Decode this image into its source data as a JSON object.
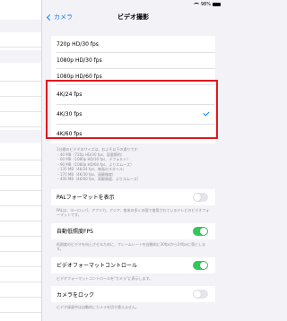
{
  "status_bar": {
    "battery_percent": "98%"
  },
  "nav": {
    "back_label": "カメラ",
    "title": "ビデオ撮影"
  },
  "resolution_options": [
    {
      "label": "720p HD/30 fps",
      "selected": false
    },
    {
      "label": "1080p HD/30 fps",
      "selected": false
    },
    {
      "label": "1080p HD/60 fps",
      "selected": false
    },
    {
      "label": "4K/24 fps",
      "selected": false
    },
    {
      "label": "4K/30 fps",
      "selected": true
    },
    {
      "label": "4K/60 fps",
      "selected": false
    }
  ],
  "size_note": {
    "line1": "1分間のビデオのサイズは、およそ以下の通りです:",
    "line2": "・40 MB（720p HD/30 fps、容量節約）",
    "line3": "・60 MB（1080p HD/30 fps、デフォルト）",
    "line4": "・90 MB（1080p HD/60 fps、よりスムーズ）",
    "line5": "・135 MB（4K/24 fps、映画のスタイル）",
    "line6": "・170 MB（4K/30 fps、高解像度）",
    "line7": "・400 MB（4K/60 fps、高解像度、よりスムーズ）"
  },
  "pal": {
    "label": "PALフォーマットを表示",
    "on": false,
    "note": "PALは、ヨーロッパ、アフリカ、アジア、南米の多くの国で使用されているテレビのビデオフォーマットです。"
  },
  "auto_fps": {
    "label": "自動低照度FPS",
    "on": true,
    "note": "低照度のビデオを向上させるために、フレームレートを自動的に30fpsから24fpsに落とします。"
  },
  "format_control": {
    "label": "ビデオフォーマットコントロール",
    "on": true,
    "note": "ビデオフォーマットコントロールを\"カメラ\"に表示します。"
  },
  "lock_camera": {
    "label": "カメラをロック",
    "on": false,
    "note": "ビデオ録画中は自動的にカメラを切り替えません。"
  },
  "colors": {
    "accent": "#0a7aff",
    "toggle_on": "#34c759",
    "highlight_border": "#e0191f"
  }
}
